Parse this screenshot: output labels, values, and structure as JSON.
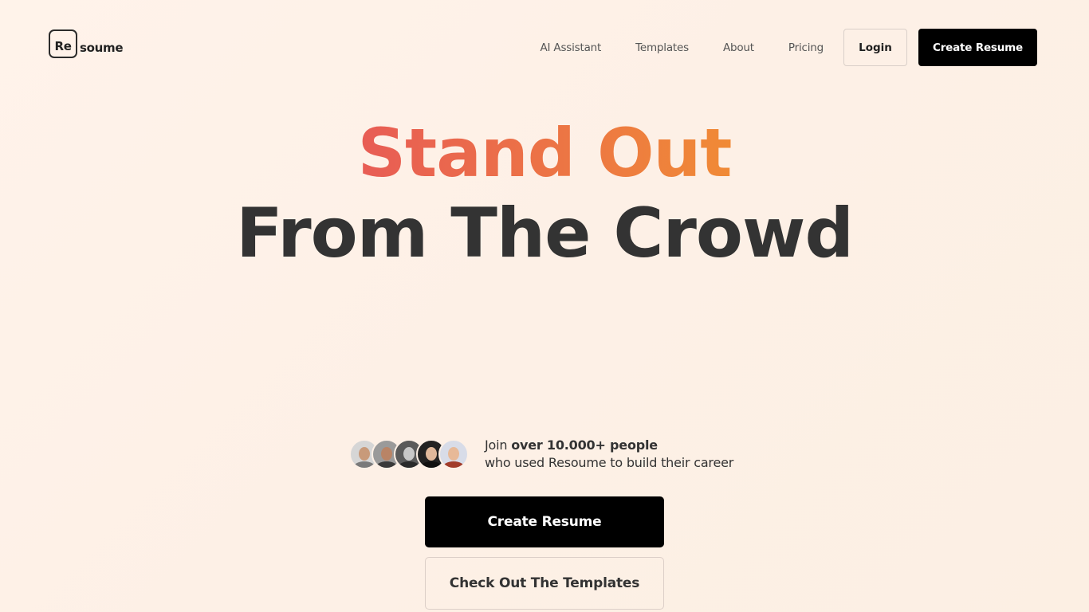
{
  "header": {
    "logo_boxed": "Re",
    "logo_rest": "soume",
    "nav": [
      "AI Assistant",
      "Templates",
      "About",
      "Pricing"
    ],
    "login_label": "Login",
    "create_label": "Create Resume"
  },
  "hero": {
    "title_line1": "Stand Out",
    "title_line2": "From The Crowd",
    "accent_gradient": [
      "#e85c55",
      "#f08a36"
    ]
  },
  "proof": {
    "join": "Join",
    "highlight": "over 10.000+ people",
    "subline": "who used Resoume to build their career",
    "avatars": [
      {
        "skin": "#c89a7a",
        "bg": "#d6d6d6",
        "shirt": "#7a7a7a"
      },
      {
        "skin": "#b98466",
        "bg": "#9a9a9a",
        "shirt": "#3a3a3a"
      },
      {
        "skin": "#c8c8c8",
        "bg": "#5a5a5a",
        "shirt": "#2a2a2a"
      },
      {
        "skin": "#e0b89a",
        "bg": "#222222",
        "shirt": "#111111"
      },
      {
        "skin": "#e7b998",
        "bg": "#d8dce8",
        "shirt": "#a23c2a"
      }
    ]
  },
  "cta": {
    "primary": "Create Resume",
    "secondary": "Check Out The Templates"
  }
}
